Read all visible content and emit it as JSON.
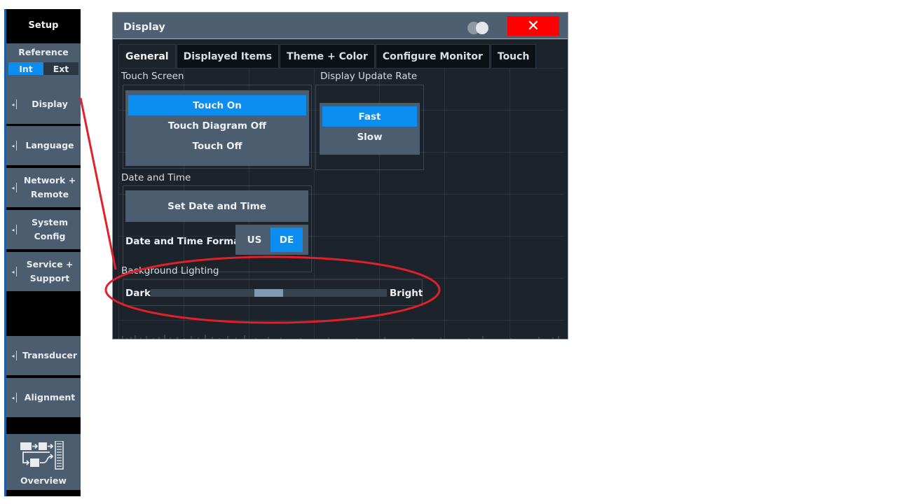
{
  "sidebar": {
    "header": "Setup",
    "reference": {
      "title": "Reference",
      "options": [
        {
          "label": "Int",
          "selected": true
        },
        {
          "label": "Ext",
          "selected": false
        }
      ]
    },
    "items": [
      {
        "label": "Display"
      },
      {
        "label": "Language"
      },
      {
        "label": "Network +\nRemote"
      },
      {
        "label": "System\nConfig"
      },
      {
        "label": "Service +\nSupport"
      },
      {
        "label": "Transducer"
      },
      {
        "label": "Alignment"
      }
    ],
    "overview": {
      "label": "Overview",
      "icon": "signal-flow-icon"
    }
  },
  "dialog": {
    "title": "Display",
    "theme_toggle_icon": "theme-toggle-icon",
    "close_icon": "✕",
    "tabs": [
      {
        "label": "General",
        "active": true
      },
      {
        "label": "Displayed Items",
        "active": false
      },
      {
        "label": "Theme + Color",
        "active": false
      },
      {
        "label": "Configure Monitor",
        "active": false
      },
      {
        "label": "Touch",
        "active": false
      }
    ],
    "touch_screen": {
      "label": "Touch Screen",
      "options": [
        {
          "label": "Touch On",
          "selected": true
        },
        {
          "label": "Touch Diagram Off",
          "selected": false
        },
        {
          "label": "Touch Off",
          "selected": false
        }
      ]
    },
    "update_rate": {
      "label": "Display Update Rate",
      "options": [
        {
          "label": "Fast",
          "selected": true
        },
        {
          "label": "Slow",
          "selected": false
        }
      ]
    },
    "date_time": {
      "label": "Date and Time",
      "set_button": "Set Date and Time",
      "format_label": "Date and Time Format",
      "format_options": [
        {
          "label": "US",
          "selected": false
        },
        {
          "label": "DE",
          "selected": true
        }
      ]
    },
    "background_lighting": {
      "label": "Background Lighting",
      "min_label": "Dark",
      "max_label": "Bright",
      "value_fraction": 0.5
    }
  },
  "colors": {
    "accent": "#0c8ef0",
    "close": "#ff0000",
    "annotation": "#e0202a",
    "panel": "#4b5d6e",
    "background": "#1d232a"
  }
}
